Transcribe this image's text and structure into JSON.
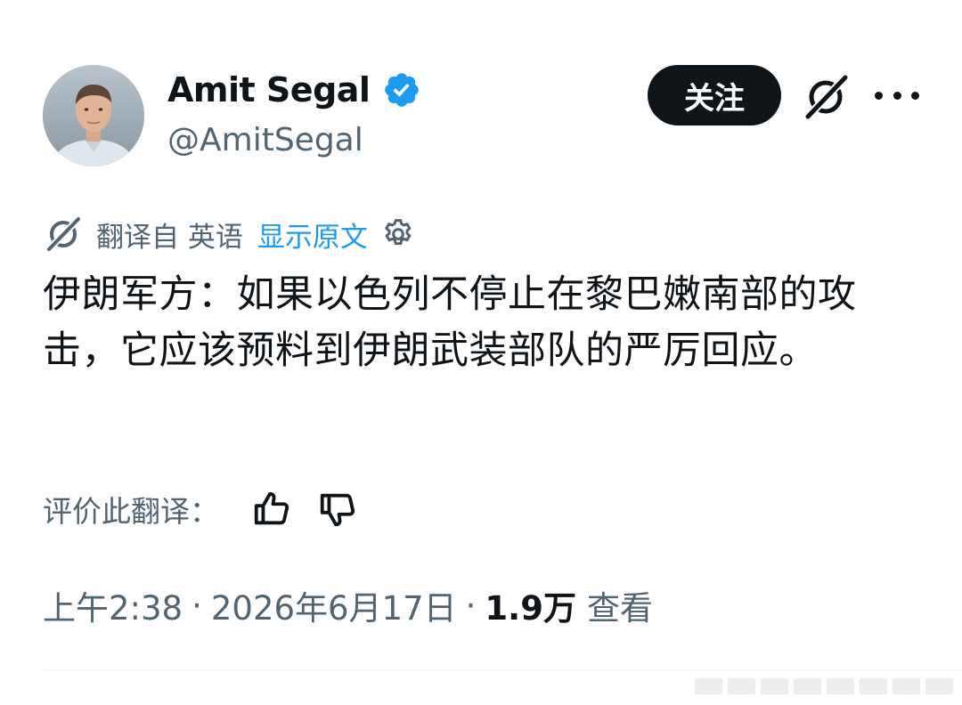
{
  "author": {
    "display_name": "Amit Segal",
    "handle": "@AmitSegal",
    "verified": true
  },
  "header": {
    "follow_label": "关注",
    "grok_icon": "grok-icon",
    "more_icon": "more-options-icon"
  },
  "translation": {
    "label": "翻译自 英语",
    "show_original_label": "显示原文",
    "settings_icon": "gear-icon"
  },
  "tweet": {
    "text": "伊朗军方：如果以色列不停止在黎巴嫩南部的攻击，它应该预料到伊朗武装部队的严厉回应。"
  },
  "rating": {
    "label": "评价此翻译：",
    "thumbs_up_icon": "thumbs-up-icon",
    "thumbs_down_icon": "thumbs-down-icon"
  },
  "meta": {
    "time": "上午2:38",
    "separator": "·",
    "date": "2026年6月17日",
    "views_count": "1.9万",
    "views_label": "查看"
  },
  "colors": {
    "text_primary": "#0f1419",
    "text_secondary": "#536471",
    "link_blue": "#1d9bf0",
    "verified_blue": "#1d9bf0",
    "button_dark": "#0f1419"
  }
}
